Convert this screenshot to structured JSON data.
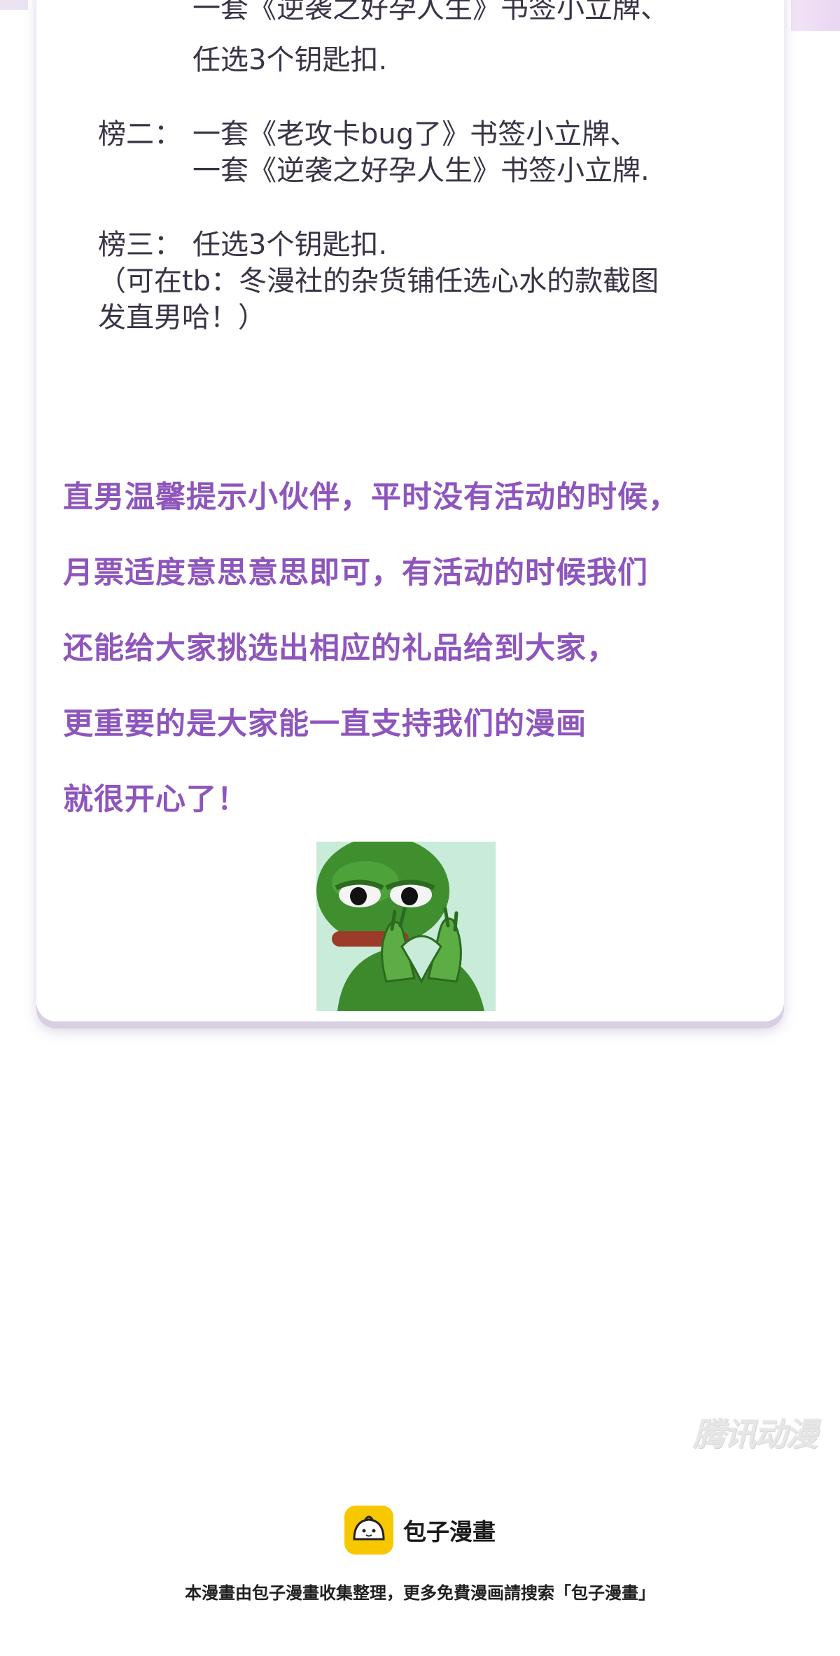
{
  "prizes": {
    "rank1_line_partial": "一套《逆袭之好孕人生》书签小立牌、",
    "rank1_line2": "任选3个钥匙扣.",
    "rank2_label": "榜二：",
    "rank2_line1": "一套《老攻卡bug了》书签小立牌、",
    "rank2_line2": "一套《逆袭之好孕人生》书签小立牌.",
    "rank3_label": "榜三：",
    "rank3_line1": "任选3个钥匙扣.",
    "note_line1": "（可在tb：冬漫社的杂货铺任选心水的款截图",
    "note_line2": "发直男哈！）"
  },
  "tips": [
    "直男温馨提示小伙伴，平时没有活动的时候，",
    "月票适度意思意思即可，有活动的时候我们",
    "还能给大家挑选出相应的礼品给到大家，",
    "更重要的是大家能一直支持我们的漫画",
    "就很开心了！"
  ],
  "colors": {
    "tip_text": "#8e55bd",
    "body_text": "#3a3346",
    "brand_yellow": "#f7c800"
  },
  "watermark": "腾讯动漫",
  "brand": {
    "name": "包子漫畫",
    "icon": "bun-logo-icon"
  },
  "footer": "本漫畫由包子漫畫收集整理，更多免費漫画請搜索「包子漫畫」"
}
